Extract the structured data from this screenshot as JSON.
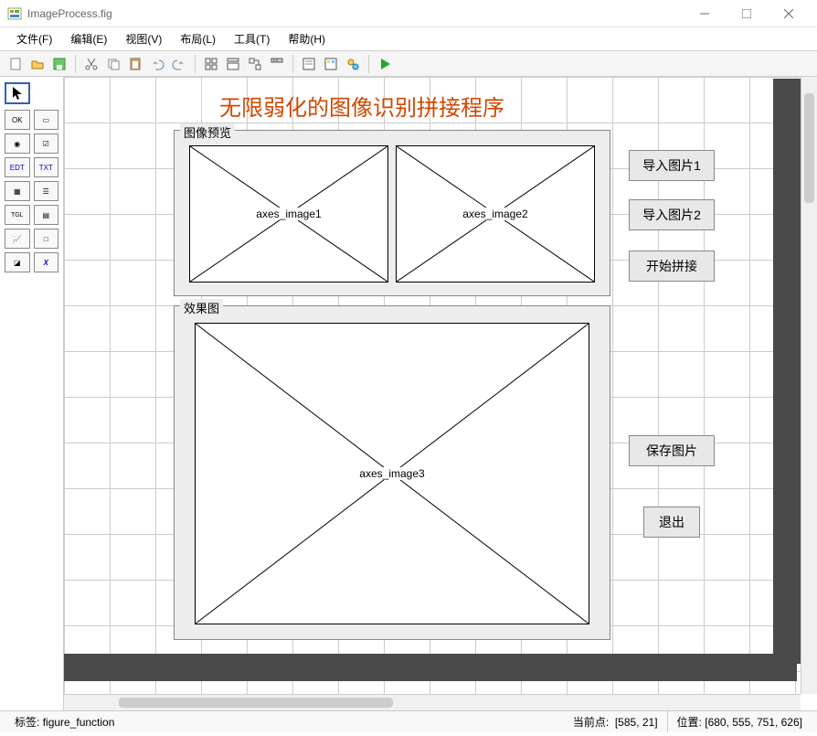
{
  "window": {
    "title": "ImageProcess.fig"
  },
  "menus": {
    "file": "文件(F)",
    "edit": "编辑(E)",
    "view": "视图(V)",
    "layout": "布局(L)",
    "tools": "工具(T)",
    "help": "帮助(H)"
  },
  "heading": "无限弱化的图像识别拼接程序",
  "panels": {
    "preview_label": "图像预览",
    "result_label": "效果图"
  },
  "axes": {
    "img1": "axes_image1",
    "img2": "axes_image2",
    "img3": "axes_image3"
  },
  "buttons": {
    "import1": "导入图片1",
    "import2": "导入图片2",
    "stitch": "开始拼接",
    "save": "保存图片",
    "exit": "退出"
  },
  "palette": {
    "ok": "OK",
    "slider": "▭",
    "radio": "◉",
    "check": "☑",
    "edit": "EDT",
    "text": "TXT",
    "popup": "▦",
    "list": "☰",
    "toggle": "TGL",
    "table": "▤",
    "axes": "📈",
    "panel": "□",
    "bgroup": "◪",
    "actx": "X"
  },
  "status": {
    "tag_label": "标签:",
    "tag_value": "figure_function",
    "curpt_label": "当前点:",
    "curpt_value": "[585, 21]",
    "pos_label": "位置:",
    "pos_value": "[680, 555, 751, 626]"
  }
}
